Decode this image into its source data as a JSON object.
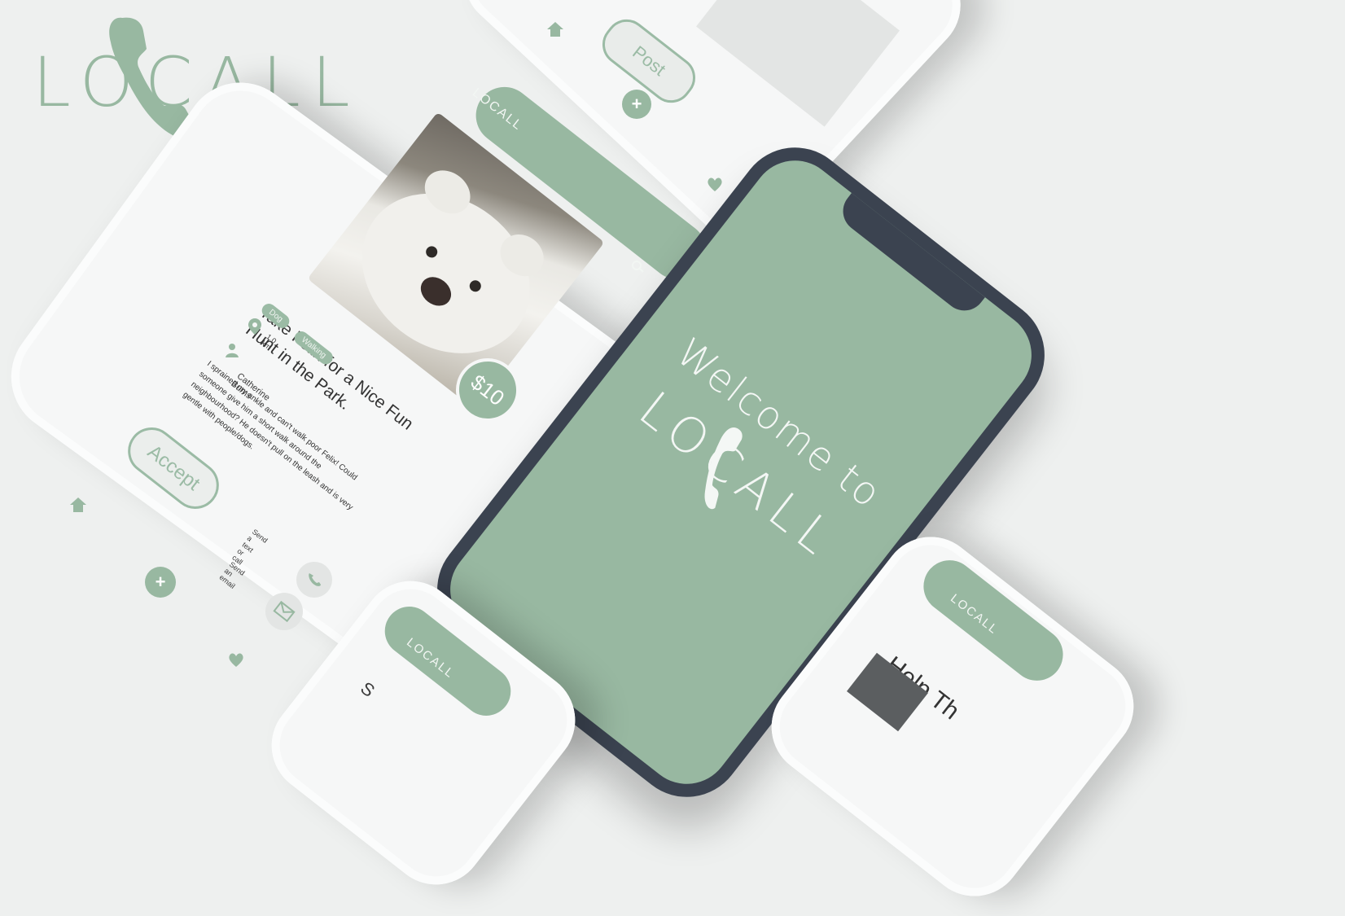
{
  "brand": {
    "logo_text": "LOCALL"
  },
  "phone_main": {
    "header_logo": "LOCALL",
    "search_icon": "search-icon",
    "post": {
      "title": "Take Felix for a Nice Fun Hunt in the Park.",
      "price": "$10",
      "tags": [
        "Dog",
        "Walking"
      ],
      "distance": "1.0 km",
      "poster_name": "Catherine Burns",
      "description": "I sprained my ankle and can't walk poor Felix! Could someone give him a short walk around the neighbourhood? He doesn't pull on the leash and is very gentle with people/dogs.",
      "accept_label": "Accept",
      "contact_text_label": "Send a text or call",
      "contact_email_label": "Send an email"
    },
    "nav": {
      "home_icon": "home-icon",
      "add_icon": "plus-icon",
      "heart_icon": "heart-icon"
    }
  },
  "phone_top": {
    "post_button_label": "Post",
    "add_symbol": "+"
  },
  "phone_dark": {
    "welcome_line": "Welcome to",
    "logo_text": "LOCALL"
  },
  "phone_bottom_mid": {
    "header_logo": "LOCALL",
    "title_fragment": "S"
  },
  "phone_bottom_right": {
    "header_logo": "LOCALL",
    "title_fragment": "Help Th"
  },
  "colors": {
    "accent": "#98b8a1",
    "background": "#eef0ef",
    "dark_phone": "#3b4350"
  }
}
